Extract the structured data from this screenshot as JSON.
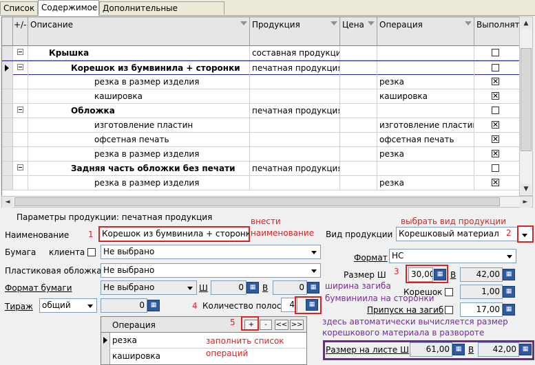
{
  "tabs": [
    "Список",
    "Содержимое",
    "Дополнительные материалы"
  ],
  "grid": {
    "columns": [
      "+/-",
      "Описание",
      "Продукция",
      "Цена",
      "Операция",
      "Выполнять"
    ],
    "rows": [
      {
        "level": 1,
        "toggle": true,
        "current": false,
        "description": "Крышка",
        "product": "составная продукция",
        "price": "",
        "operation": "",
        "checked": false
      },
      {
        "level": 2,
        "toggle": true,
        "current": true,
        "description": "Корешок из бумвинила + сторонки",
        "product": "печатная продукция",
        "price": "",
        "operation": "",
        "checked": false
      },
      {
        "level": 3,
        "toggle": false,
        "current": false,
        "description": "резка в размер изделия",
        "product": "",
        "price": "",
        "operation": "резка",
        "checked": true
      },
      {
        "level": 3,
        "toggle": false,
        "current": false,
        "description": "кашировка",
        "product": "",
        "price": "",
        "operation": "кашировка",
        "checked": true
      },
      {
        "level": 2,
        "toggle": true,
        "current": false,
        "description": "Обложка",
        "product": "печатная продукция",
        "price": "",
        "operation": "",
        "checked": false
      },
      {
        "level": 3,
        "toggle": false,
        "current": false,
        "description": "изготовление пластин",
        "product": "",
        "price": "",
        "operation": "изготовление пластин",
        "checked": true
      },
      {
        "level": 3,
        "toggle": false,
        "current": false,
        "description": "офсетная печать",
        "product": "",
        "price": "",
        "operation": "офсетная печать",
        "checked": true
      },
      {
        "level": 3,
        "toggle": false,
        "current": false,
        "description": "резка в размер изделия",
        "product": "",
        "price": "",
        "operation": "резка",
        "checked": true
      },
      {
        "level": 2,
        "toggle": true,
        "current": false,
        "description": "Задняя часть обложки без печати",
        "product": "печатная продукция",
        "price": "",
        "operation": "",
        "checked": false
      },
      {
        "level": 3,
        "toggle": false,
        "current": false,
        "description": "резка в размер изделия",
        "product": "",
        "price": "",
        "operation": "резка",
        "checked": true
      }
    ]
  },
  "params": {
    "title": "Параметры продукции: печатная продукция",
    "name_label": "Наименование",
    "name_value": "Корешок из бумвинила + сторонки",
    "product_type_label": "Вид продукции",
    "product_type_value": "Корешковый материал",
    "paper_label": "Бумага",
    "client_label": "клиента",
    "paper_value": "Не выбрано",
    "plastic_label": "Пластиковая обложка",
    "plastic_value": "Не выбрано",
    "paper_format_label": "Формат бумаги",
    "paper_format_value": "Не выбрано",
    "w_label": "Ш",
    "w_value": "0",
    "h_label": "В",
    "h_value": "0",
    "circulation_label": "Тираж",
    "circulation_type": "общий",
    "circulation_value": "0",
    "strips_label": "Количество полос",
    "strips_value": "4",
    "format_label": "Формат",
    "format_value": "НС",
    "size_w_label": "Размер Ш",
    "size_w_value": "30,00",
    "size_h_label": "В",
    "size_h_value": "42,00",
    "spine_label": "Корешок",
    "spine_value": "1,00",
    "fold_label": "Припуск на загиб",
    "fold_value": "17,00",
    "sheet_w_label": "Размер на листе Ш",
    "sheet_w_value": "61,00",
    "sheet_h_label": "В",
    "sheet_h_value": "42,00"
  },
  "operations": {
    "header": "Операция",
    "buttons": [
      "+",
      "-",
      "<<",
      ">>"
    ],
    "items": [
      "резка",
      "кашировка"
    ]
  },
  "annotations": {
    "enter_name": "внести\nнаименование",
    "choose_type": "выбрать вид продукции",
    "fold_width": "ширина загиба\nбумвиниила на сторонки",
    "auto_calc": "здесь автоматически вычисляется размер\nкорешкового материала в развороте",
    "fill_ops": "заполнить список\nопераций",
    "n1": "1",
    "n2": "2",
    "n3": "3",
    "n4": "4",
    "n5": "5"
  },
  "colors": {
    "annotation_red": "#e02020",
    "annotation_purple": "#7a2a9a",
    "calc_button": "#2d5aa0"
  }
}
